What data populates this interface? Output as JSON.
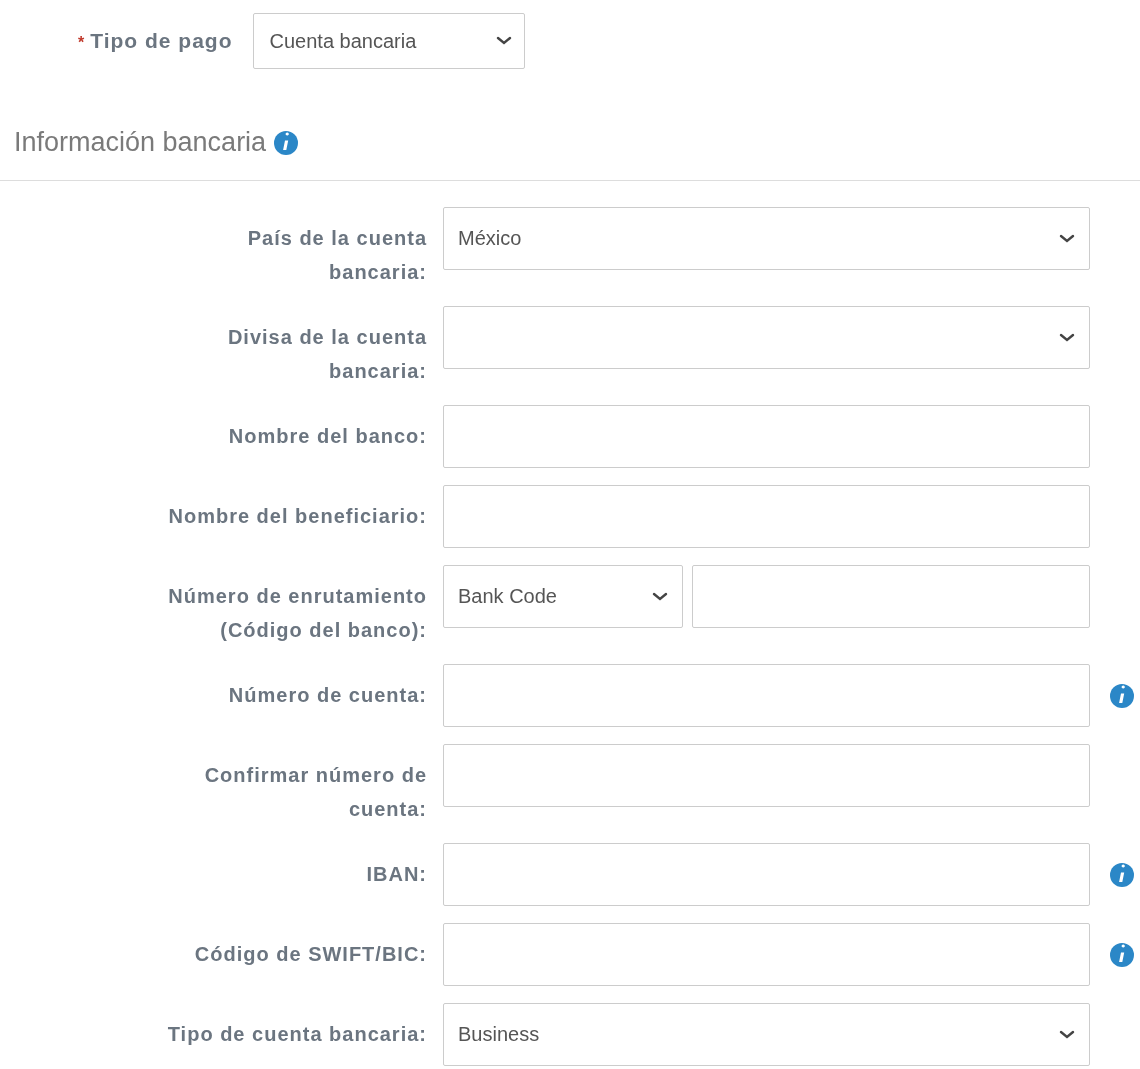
{
  "payment_type": {
    "required_mark": "*",
    "label": "Tipo de pago",
    "value": "Cuenta bancaria"
  },
  "section": {
    "title": "Información bancaria"
  },
  "fields": [
    {
      "label": "País de la cuenta\nbancaria:",
      "kind": "select",
      "value": "México",
      "info": false
    },
    {
      "label": "Divisa de la cuenta\nbancaria:",
      "kind": "select",
      "info": false
    },
    {
      "label": "Nombre del banco:",
      "kind": "text",
      "info": false
    },
    {
      "label": "Nombre del beneficiario:",
      "kind": "text",
      "info": false
    },
    {
      "label": "Número de enrutamiento\n(Código del banco):",
      "kind": "split",
      "value": "Bank Code",
      "info": false
    },
    {
      "label": "Número de cuenta:",
      "kind": "text",
      "info": true
    },
    {
      "label": "Confirmar número de\ncuenta:",
      "kind": "text",
      "info": false
    },
    {
      "label": "IBAN:",
      "kind": "text",
      "info": true
    },
    {
      "label": "Código de SWIFT/BIC:",
      "kind": "text",
      "info": true
    },
    {
      "label": "Tipo de cuenta bancaria:",
      "kind": "select",
      "value": "Business",
      "info": false
    }
  ]
}
